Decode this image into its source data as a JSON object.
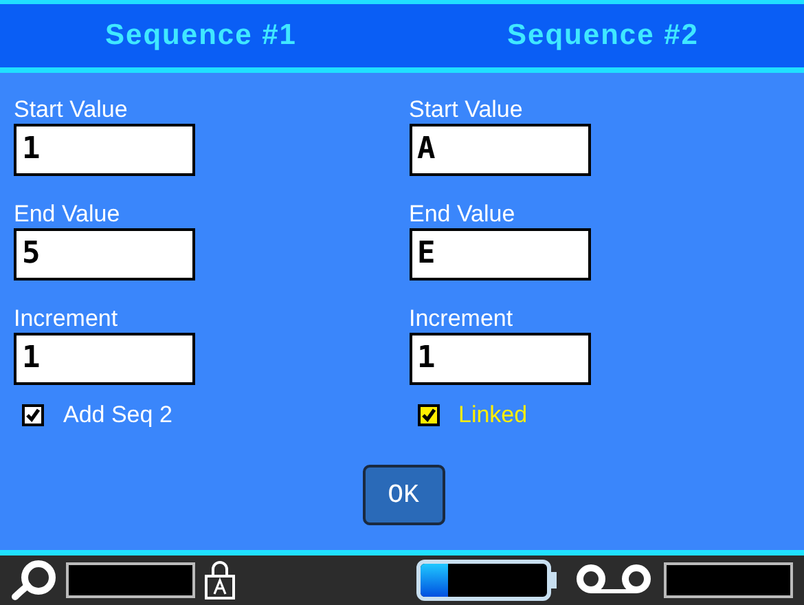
{
  "columns": [
    {
      "title": "Sequence #1",
      "fields": [
        {
          "label": "Start Value",
          "value": "1"
        },
        {
          "label": "End Value",
          "value": "5"
        },
        {
          "label": "Increment",
          "value": "1"
        }
      ],
      "checkbox": {
        "label": "Add Seq 2",
        "checked": true,
        "focused": false
      }
    },
    {
      "title": "Sequence #2",
      "fields": [
        {
          "label": "Start Value",
          "value": "A"
        },
        {
          "label": "End Value",
          "value": "E"
        },
        {
          "label": "Increment",
          "value": "1"
        }
      ],
      "checkbox": {
        "label": "Linked",
        "checked": true,
        "focused": true
      }
    }
  ],
  "ok_button": "OK",
  "status_bar": {
    "battery": {
      "level": 0.22
    }
  }
}
